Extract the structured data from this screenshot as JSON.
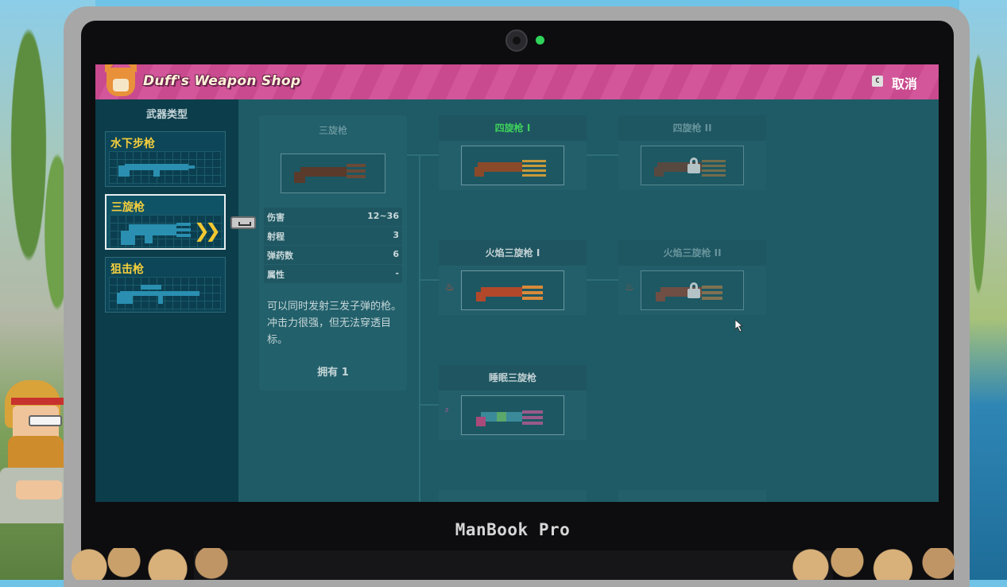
{
  "device": {
    "brand": "ManBook Pro"
  },
  "shop": {
    "title": "Duff's Weapon Shop",
    "cancel_key": "C",
    "cancel_label": "取消"
  },
  "sidebar": {
    "title": "武器类型",
    "categories": [
      {
        "label": "水下步枪",
        "selected": false
      },
      {
        "label": "三旋枪",
        "selected": true
      },
      {
        "label": "狙击枪",
        "selected": false
      }
    ]
  },
  "detail": {
    "title": "三旋枪",
    "stats": [
      {
        "label": "伤害",
        "value": "12~36"
      },
      {
        "label": "射程",
        "value": "3"
      },
      {
        "label": "弹药数",
        "value": "6"
      },
      {
        "label": "属性",
        "value": "-"
      }
    ],
    "description": "可以同时发射三发子弹的枪。冲击力很强，但无法穿透目标。",
    "owned": "拥有 1"
  },
  "upgrades": [
    {
      "title": "四旋枪 I",
      "state": "unlocked"
    },
    {
      "title": "四旋枪 II",
      "state": "locked"
    },
    {
      "title": "火焰三旋枪 I",
      "state": "available",
      "element_icon": "fire-icon"
    },
    {
      "title": "火焰三旋枪 II",
      "state": "locked",
      "element_icon": "fire-icon"
    },
    {
      "title": "睡眠三旋枪",
      "state": "available",
      "element_icon": "sleep-icon"
    }
  ],
  "colors": {
    "accent_pink": "#cc4f92",
    "category_label": "#f6cf3c",
    "unlocked_green": "#3fd05b",
    "panel_teal": "#1f5b66"
  }
}
